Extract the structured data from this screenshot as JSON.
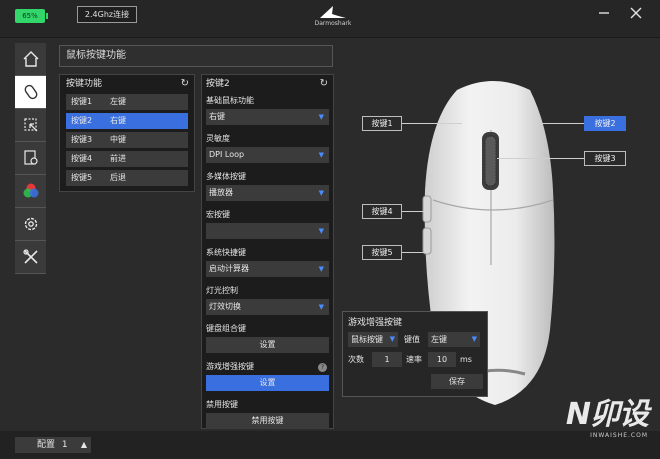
{
  "header": {
    "battery": "65%",
    "connection": "2.4Ghz连接",
    "logo_text": "Darmoshark",
    "minimize_icon": "minimize-icon",
    "close_icon": "close-icon"
  },
  "sidebar": {
    "items": [
      {
        "name": "home",
        "icon": "home-icon"
      },
      {
        "name": "mouse-buttons",
        "icon": "mouse-icon",
        "active": true
      },
      {
        "name": "macro",
        "icon": "macro-edit-icon"
      },
      {
        "name": "performance",
        "icon": "settings-sheet-icon"
      },
      {
        "name": "lighting",
        "icon": "rgb-color-icon"
      },
      {
        "name": "settings",
        "icon": "gear-icon"
      },
      {
        "name": "tools",
        "icon": "tools-icon"
      }
    ]
  },
  "panel": {
    "title": "鼠标按键功能"
  },
  "keylist": {
    "title": "按键功能",
    "refresh_icon": "refresh-icon",
    "rows": [
      {
        "key": "按键1",
        "func": "左键"
      },
      {
        "key": "按键2",
        "func": "右键",
        "selected": true
      },
      {
        "key": "按键3",
        "func": "中键"
      },
      {
        "key": "按键4",
        "func": "前进"
      },
      {
        "key": "按键5",
        "func": "后退"
      }
    ]
  },
  "detail": {
    "title": "按键2",
    "basic_label": "基础鼠标功能",
    "basic_value": "右键",
    "sens_label": "灵敏度",
    "sens_value": "DPI Loop",
    "media_label": "多媒体按键",
    "media_value": "播放器",
    "macro_label": "宏按键",
    "macro_value": "",
    "shortcut_label": "系统快捷键",
    "shortcut_value": "启动计算器",
    "light_label": "灯光控制",
    "light_value": "灯效切换",
    "combo_label": "键盘组合键",
    "combo_button": "设置",
    "game_label": "游戏增强按键",
    "game_help": "?",
    "game_button": "设置",
    "disable_label": "禁用按键",
    "disable_button": "禁用按键"
  },
  "mouse": {
    "callouts": [
      {
        "label": "按键1"
      },
      {
        "label": "按键2",
        "selected": true
      },
      {
        "label": "按键3"
      },
      {
        "label": "按键4"
      },
      {
        "label": "按键5"
      }
    ]
  },
  "game_panel": {
    "title": "游戏增强按键",
    "type_value": "鼠标按键",
    "key_label": "键值",
    "key_value": "左键",
    "count_label": "次数",
    "count_value": "1",
    "rate_label": "速率",
    "rate_value": "10",
    "rate_unit": "ms",
    "save_button": "保存"
  },
  "footer": {
    "profile_label": "配置",
    "profile_number": "1"
  },
  "watermark": {
    "brand": "N卯设",
    "site": "INWAISHE.COM"
  },
  "colors": {
    "accent": "#3a6fe0",
    "battery": "#33d66a",
    "arrow": "#4a8cff"
  }
}
